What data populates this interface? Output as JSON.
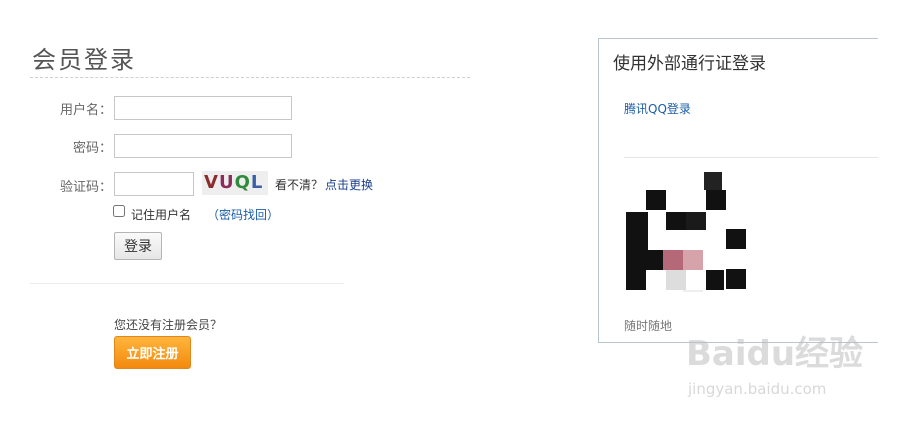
{
  "login": {
    "title": "会员登录",
    "username_label": "用户名：",
    "password_label": "密码：",
    "captcha_label": "验证码：",
    "captcha_chars": [
      "V",
      "U",
      "Q",
      "L"
    ],
    "unclear_text": "看不清？",
    "refresh_link": "点击更换",
    "remember_label": "记住用户名",
    "recover_link": "密码找回",
    "paren_open": "（",
    "paren_close": "）",
    "submit_label": "登录"
  },
  "register": {
    "prompt": "您还没有注册会员？",
    "button_label": "立即注册"
  },
  "external_login": {
    "title": "使用外部通行证登录",
    "qq_link": "腾讯QQ登录",
    "qr_caption": "随时随地"
  },
  "watermark": {
    "logo": "Baidu经验",
    "url": "jingyan.baidu.com"
  }
}
